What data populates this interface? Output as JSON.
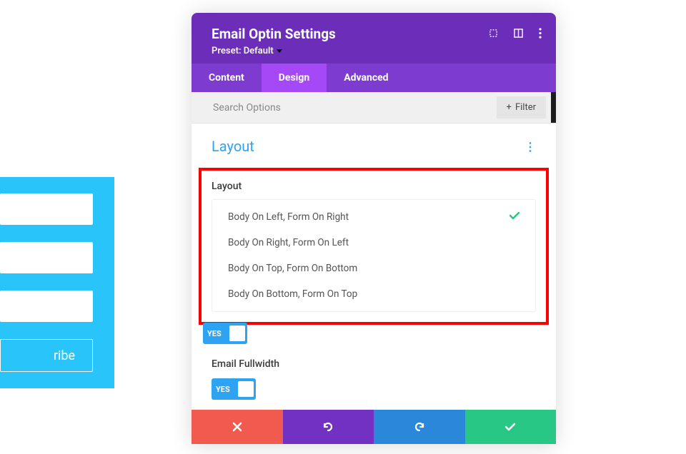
{
  "background": {
    "subscribe_text": "ribe"
  },
  "modal": {
    "title": "Email Optin Settings",
    "preset_label": "Preset: Default"
  },
  "tabs": {
    "content": "Content",
    "design": "Design",
    "advanced": "Advanced"
  },
  "search": {
    "placeholder": "Search Options",
    "filter_label": "Filter"
  },
  "section": {
    "title": "Layout"
  },
  "layout": {
    "label": "Layout",
    "options": [
      "Body On Left, Form On Right",
      "Body On Right, Form On Left",
      "Body On Top, Form On Bottom",
      "Body On Bottom, Form On Top"
    ]
  },
  "toggle": {
    "yes": "YES"
  },
  "email_fullwidth": {
    "label": "Email Fullwidth"
  }
}
